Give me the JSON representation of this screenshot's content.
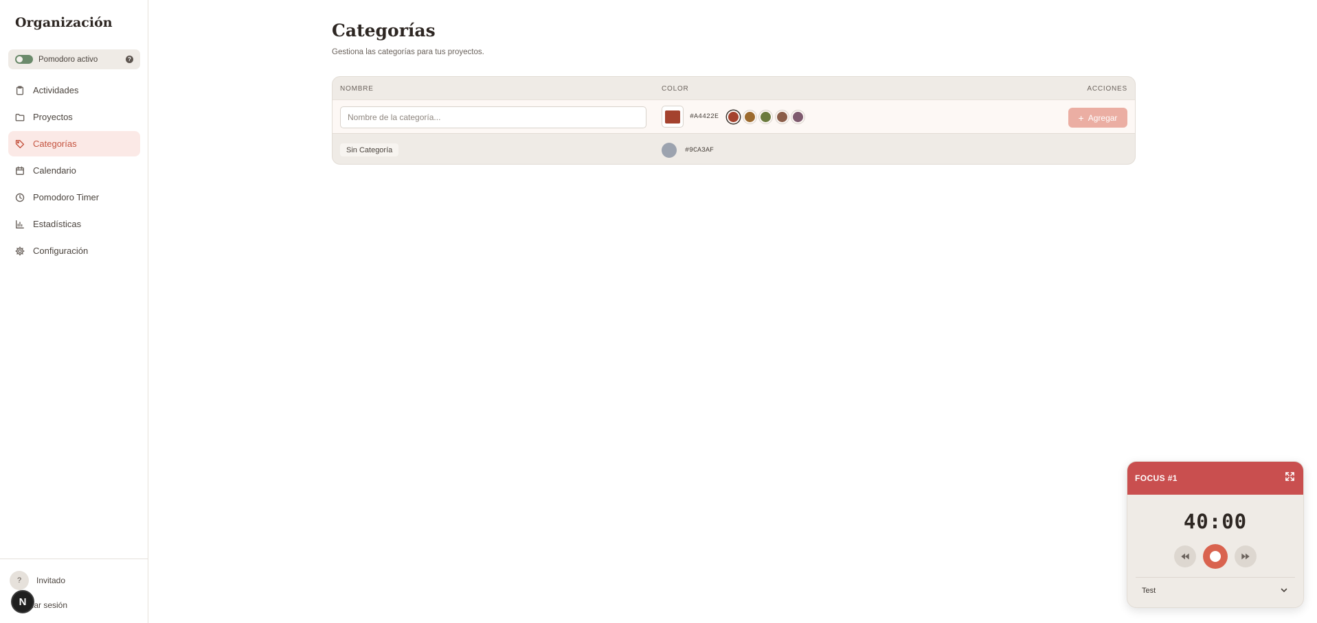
{
  "app": {
    "brand": "Organización"
  },
  "pomodoro_toggle": {
    "label": "Pomodoro activo",
    "help": "?"
  },
  "nav": [
    {
      "label": "Actividades",
      "icon": "clipboard-icon"
    },
    {
      "label": "Proyectos",
      "icon": "folder-icon"
    },
    {
      "label": "Categorías",
      "icon": "tag-icon",
      "active": true
    },
    {
      "label": "Calendario",
      "icon": "calendar-icon"
    },
    {
      "label": "Pomodoro Timer",
      "icon": "clock-icon"
    },
    {
      "label": "Estadísticas",
      "icon": "bar-chart-icon"
    },
    {
      "label": "Configuración",
      "icon": "gear-icon"
    }
  ],
  "user": {
    "avatar": "?",
    "name": "Invitado",
    "login": "iciar sesión"
  },
  "next_badge": "N",
  "page": {
    "title": "Categorías",
    "subtitle": "Gestiona las categorías para tus proyectos."
  },
  "table": {
    "headers": {
      "name": "NOMBRE",
      "color": "COLOR",
      "actions": "ACCIONES"
    },
    "new_row": {
      "placeholder": "Nombre de la categoría...",
      "selected_color": "#A4422E",
      "hex_label": "#A4422E",
      "swatches": [
        "#A4422E",
        "#9C6A2E",
        "#6B7B3E",
        "#8B5E4A",
        "#7E5A6E"
      ],
      "add_label": "Agregar"
    },
    "rows": [
      {
        "name": "Sin Categoría",
        "color": "#9CA3AF",
        "hex_label": "#9CA3AF"
      }
    ]
  },
  "widget": {
    "title": "FOCUS #1",
    "time": "40:00",
    "task": "Test",
    "header_color": "#C94F4F"
  }
}
